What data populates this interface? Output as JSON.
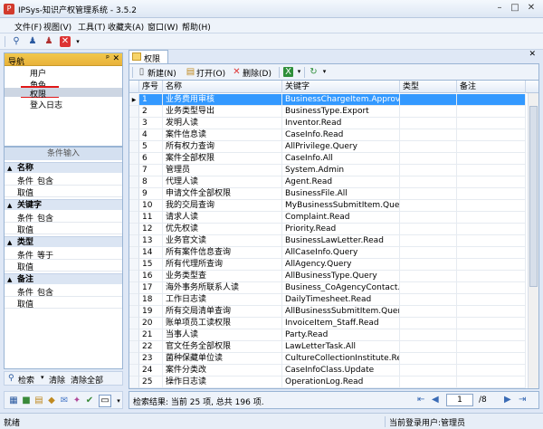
{
  "window": {
    "title": "IPSys-知识产权管理系统 - 3.5.2",
    "app_icon": "ipsys-icon",
    "min": "–",
    "max": "□",
    "close": "✕"
  },
  "menu": [
    "文件(F)",
    "视图(V)",
    "工具(T)",
    "收藏夹(A)",
    "窗口(W)",
    "帮助(H)"
  ],
  "toolbar": {
    "icons": [
      "search-icon",
      "user-config-icon",
      "user-delete-icon",
      "close-icon"
    ]
  },
  "nav": {
    "title": "导航",
    "pin": "ᵖ",
    "close": "✕",
    "items": [
      "用户",
      "角色",
      "权限",
      "登入日志"
    ],
    "selected": 2
  },
  "conditions": {
    "title": "条件输入",
    "groups": [
      {
        "label": "名称",
        "cond_label": "条件",
        "cond_value": "包含",
        "value_label": "取值",
        "value": ""
      },
      {
        "label": "关键字",
        "cond_label": "条件",
        "cond_value": "包含",
        "value_label": "取值",
        "value": ""
      },
      {
        "label": "类型",
        "cond_label": "条件",
        "cond_value": "等于",
        "value_label": "取值",
        "value": ""
      },
      {
        "label": "备注",
        "cond_label": "条件",
        "cond_value": "包含",
        "value_label": "取值",
        "value": ""
      }
    ]
  },
  "search": {
    "search": "检索",
    "clear": "清除",
    "clear_all": "清除全部"
  },
  "tab": {
    "label": "权限",
    "close": "✕"
  },
  "grid_toolbar": {
    "new": "新建(N)",
    "open": "打开(O)",
    "delete": "删除(D)"
  },
  "grid": {
    "columns": [
      "序号",
      "名称",
      "关键字",
      "类型",
      "备注"
    ],
    "selected_row": 0,
    "rows": [
      [
        "1",
        "业务费用审核",
        "BusinessChargeItem.ApproveDate",
        "",
        ""
      ],
      [
        "2",
        "业务类型导出",
        "BusinessType.Export",
        "",
        ""
      ],
      [
        "3",
        "发明人读",
        "Inventor.Read",
        "",
        ""
      ],
      [
        "4",
        "案件信息读",
        "CaseInfo.Read",
        "",
        ""
      ],
      [
        "5",
        "所有权力查询",
        "AllPrivilege.Query",
        "",
        ""
      ],
      [
        "6",
        "案件全部权限",
        "CaseInfo.All",
        "",
        ""
      ],
      [
        "7",
        "管理员",
        "System.Admin",
        "",
        ""
      ],
      [
        "8",
        "代理人读",
        "Agent.Read",
        "",
        ""
      ],
      [
        "9",
        "申请文件全部权限",
        "BusinessFile.All",
        "",
        ""
      ],
      [
        "10",
        "我的交局查询",
        "MyBusinessSubmitItem.Query",
        "",
        ""
      ],
      [
        "11",
        "请求人读",
        "Complaint.Read",
        "",
        ""
      ],
      [
        "12",
        "优先权读",
        "Priority.Read",
        "",
        ""
      ],
      [
        "13",
        "业务官文读",
        "BusinessLawLetter.Read",
        "",
        ""
      ],
      [
        "14",
        "所有案件信息查询",
        "AllCaseInfo.Query",
        "",
        ""
      ],
      [
        "15",
        "所有代理所查询",
        "AllAgency.Query",
        "",
        ""
      ],
      [
        "16",
        "业务类型查",
        "AllBusinessType.Query",
        "",
        ""
      ],
      [
        "17",
        "海外事务所联系人读",
        "Business_CoAgencyContact.Read",
        "",
        ""
      ],
      [
        "18",
        "工作日志读",
        "DailyTimesheet.Read",
        "",
        ""
      ],
      [
        "19",
        "所有交局清单查询",
        "AllBusinessSubmitItem.Query",
        "",
        ""
      ],
      [
        "20",
        "账单项员工读权限",
        "InvoiceItem_Staff.Read",
        "",
        ""
      ],
      [
        "21",
        "当事人读",
        "Party.Read",
        "",
        ""
      ],
      [
        "22",
        "官文任务全部权限",
        "LawLetterTask.All",
        "",
        ""
      ],
      [
        "23",
        "菌种保藏单位读",
        "CultureCollectionInstitute.Read",
        "",
        ""
      ],
      [
        "24",
        "案件分类改",
        "CaseInfoClass.Update",
        "",
        ""
      ],
      [
        "25",
        "操作日志读",
        "OperationLog.Read",
        "",
        ""
      ]
    ]
  },
  "pager": {
    "summary": "检索结果: 当前 25 项, 总共 196 项.",
    "current_page": "1",
    "total_pages": "/8"
  },
  "status": {
    "left": "就绪",
    "right": "当前登录用户:管理员"
  }
}
